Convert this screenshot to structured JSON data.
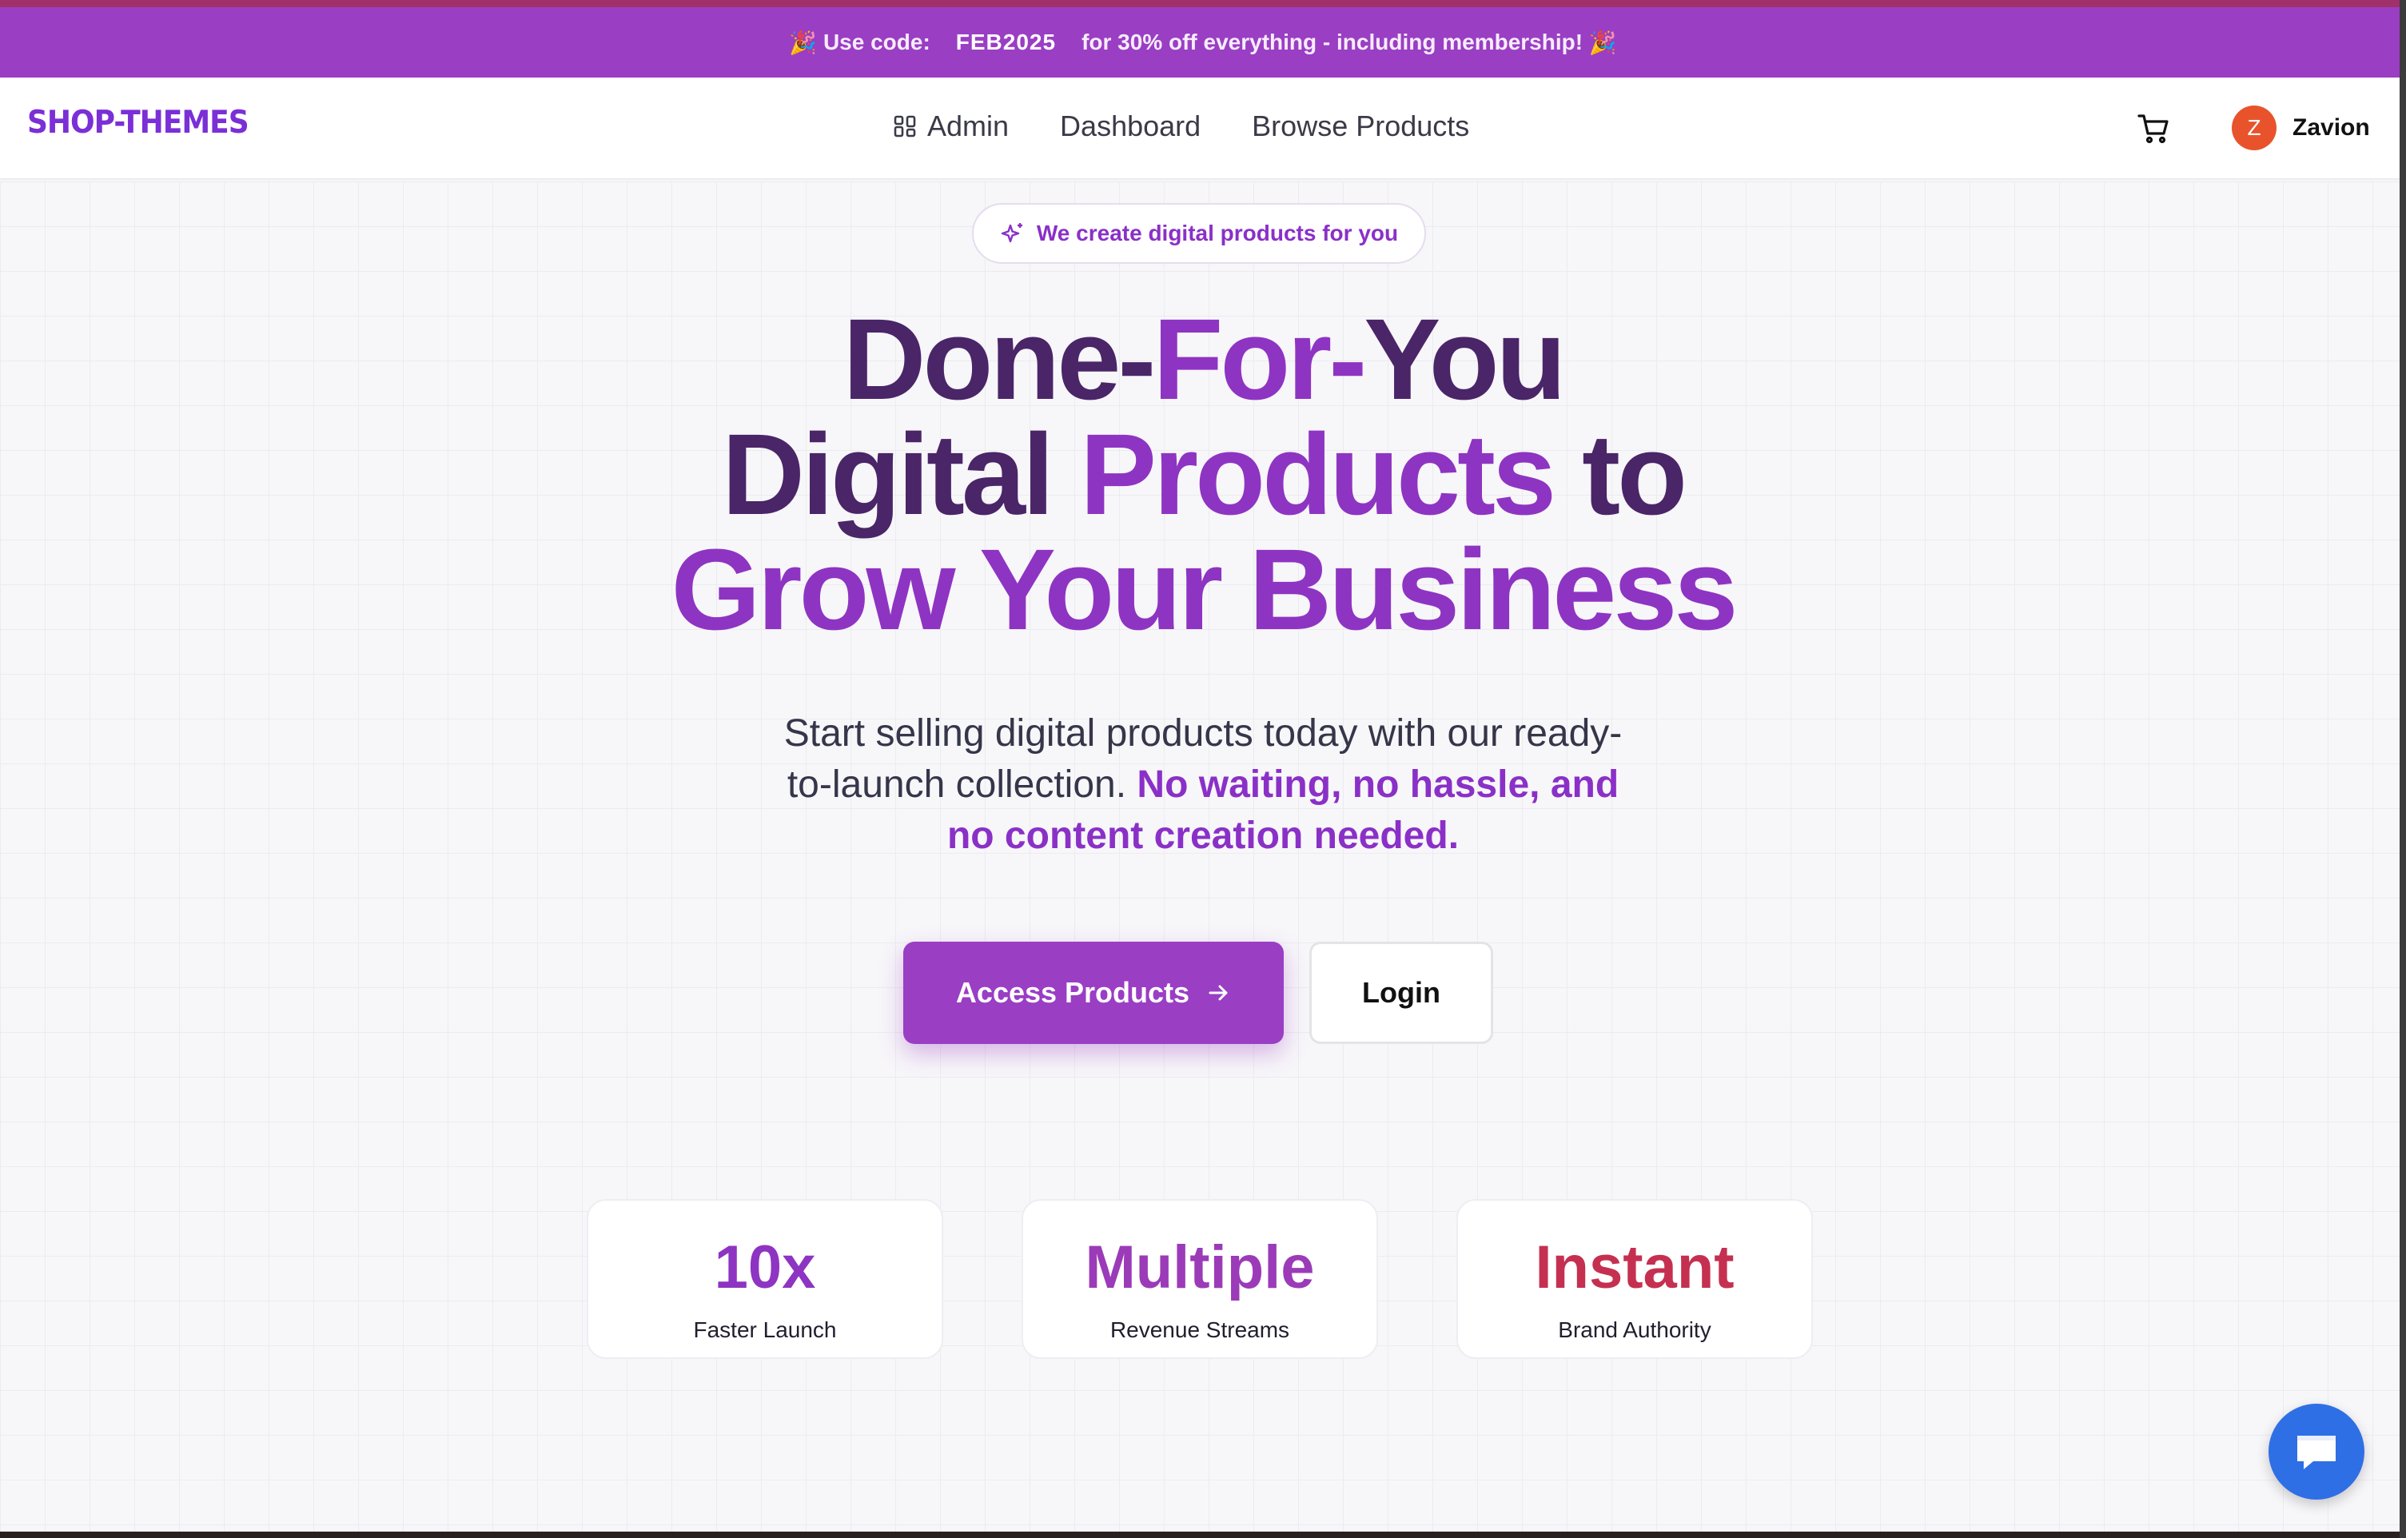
{
  "promo": {
    "emoji_left": "🎉",
    "prefix": "Use code:",
    "code": "FEB2025",
    "suffix": "for 30% off everything - including membership!",
    "emoji_right": "🎉"
  },
  "header": {
    "logo": "SHOP-THEMES",
    "nav": [
      {
        "label": "Admin",
        "icon": "grid-icon"
      },
      {
        "label": "Dashboard"
      },
      {
        "label": "Browse Products"
      }
    ],
    "cart_icon": "cart-icon",
    "user": {
      "initial": "Z",
      "name": "Zavion"
    }
  },
  "hero": {
    "badge": "We create digital products for you",
    "badge_icon": "sparkle-icon",
    "headline": {
      "line1_a": "Done-",
      "line1_b": "For-",
      "line1_c": "You",
      "line2_a": "Digital ",
      "line2_b": "Products ",
      "line2_c": "to",
      "line3": "Grow Your Business"
    },
    "subtitle_plain": "Start selling digital products today with our ready-to-launch collection.",
    "subtitle_highlight": "No waiting, no hassle, and no content creation needed.",
    "primary_button": "Access Products",
    "secondary_button": "Login"
  },
  "stats": [
    {
      "value": "10x",
      "label": "Faster Launch",
      "color": "#8e34c2"
    },
    {
      "value": "Multiple",
      "label": "Revenue Streams",
      "color": "#9b3bb8"
    },
    {
      "value": "Instant",
      "label": "Brand Authority",
      "color": "#c53050"
    }
  ],
  "colors": {
    "brand": "#9a3ec4",
    "dark": "#4a2568",
    "chat": "#2f6fe6",
    "avatar": "#e8532c"
  },
  "chat_icon": "chat-bubble-icon"
}
